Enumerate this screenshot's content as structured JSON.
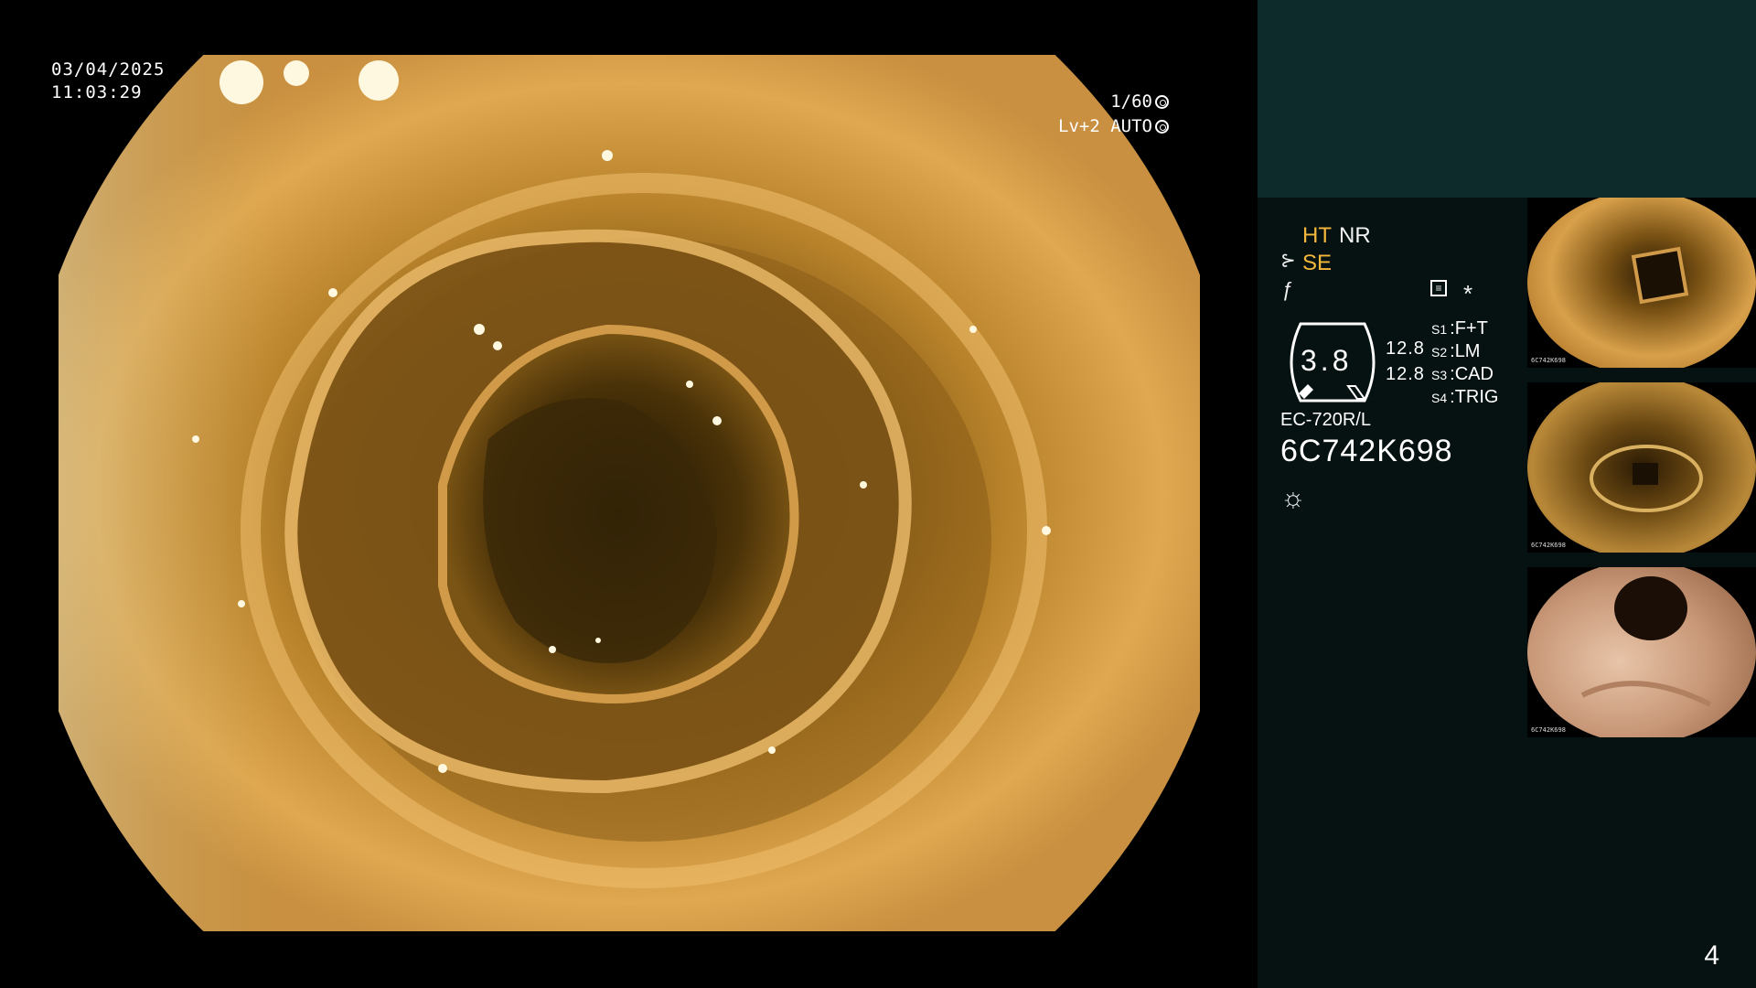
{
  "overlay": {
    "date": "03/04/2025",
    "time": "11:03:29",
    "shutter": "1/60",
    "level": "Lv+2 AUTO"
  },
  "panel": {
    "ht_label": "HT",
    "nr_label": "NR",
    "se_label": "SE",
    "gauge_value": "3.8",
    "side_values": [
      "12.8",
      "12.8"
    ],
    "switches": [
      {
        "key": "S1",
        "value": "F+T"
      },
      {
        "key": "S2",
        "value": "LM"
      },
      {
        "key": "S3",
        "value": "CAD"
      },
      {
        "key": "S4",
        "value": "TRIG"
      }
    ],
    "model": "EC-720R/L",
    "serial": "6C742K698"
  },
  "thumbnails": [
    {
      "label": "6C742K698"
    },
    {
      "label": "6C742K698"
    },
    {
      "label": "6C742K698"
    }
  ],
  "page_number": "4",
  "icons": [
    "shutter-icon",
    "auto-icon",
    "scope-icon",
    "lightning-icon",
    "menu-icon",
    "asterisk-icon",
    "light-icon"
  ],
  "colors": {
    "accent": "#f5b83d",
    "panel_top": "#0e2b2c",
    "panel_bottom": "#051211"
  }
}
